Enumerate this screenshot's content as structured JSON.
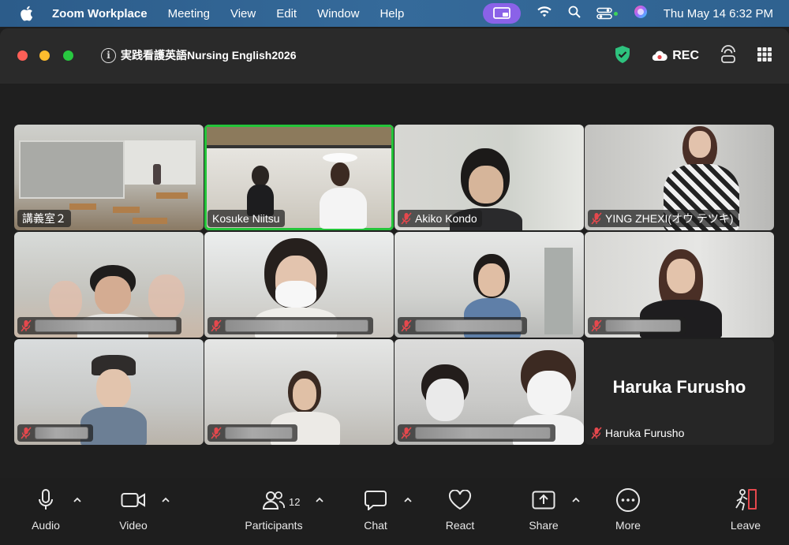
{
  "menubar": {
    "app_name": "Zoom Workplace",
    "items": [
      "Meeting",
      "View",
      "Edit",
      "Window",
      "Help"
    ],
    "clock": "Thu May 14  6:32 PM"
  },
  "window": {
    "meeting_title": "実践看護英語Nursing English2026",
    "rec_label": "REC"
  },
  "tiles": [
    {
      "name": "講義室２"
    },
    {
      "name": "Kosuke Niitsu"
    },
    {
      "name": "Akiko Kondo"
    },
    {
      "name": "YING ZHEXI(オウ テツキ)"
    },
    {
      "name": ""
    },
    {
      "name": ""
    },
    {
      "name": ""
    },
    {
      "name": ""
    },
    {
      "name": ""
    },
    {
      "name": ""
    },
    {
      "name": ""
    },
    {
      "name": "Haruka Furusho",
      "big_name": "Haruka Furusho"
    }
  ],
  "toolbar": {
    "audio": "Audio",
    "video": "Video",
    "participants": "Participants",
    "participants_count": "12",
    "chat": "Chat",
    "react": "React",
    "share": "Share",
    "more": "More",
    "leave": "Leave"
  },
  "colors": {
    "active_speaker": "#24c43a",
    "leave": "#e5484d",
    "share_pill": "#8a62e8"
  }
}
